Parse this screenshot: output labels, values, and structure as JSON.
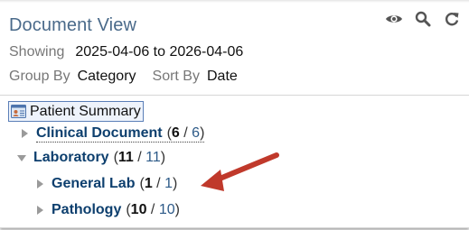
{
  "header": {
    "title": "Document View"
  },
  "toolbar": {
    "icons": [
      "eye-icon",
      "search-icon",
      "refresh-icon"
    ]
  },
  "filters": {
    "showing_label": "Showing",
    "showing_value": "2025-04-06 to 2026-04-06",
    "group_by_label": "Group By",
    "group_by_value": "Category",
    "sort_by_label": "Sort By",
    "sort_by_value": "Date"
  },
  "tree": {
    "root_label": "Patient Summary",
    "nodes": [
      {
        "name": "Clinical Document",
        "count_a": "6",
        "count_b": "6",
        "state": "collapsed"
      },
      {
        "name": "Laboratory",
        "count_a": "11",
        "count_b": "11",
        "state": "expanded"
      },
      {
        "name": "General Lab",
        "count_a": "1",
        "count_b": "1",
        "state": "collapsed"
      },
      {
        "name": "Pathology",
        "count_a": "10",
        "count_b": "10",
        "state": "collapsed"
      }
    ],
    "separator": " / "
  },
  "colors": {
    "title": "#4a6a8a",
    "node_name": "#0d3f6e",
    "annotation_arrow": "#c0392b"
  }
}
